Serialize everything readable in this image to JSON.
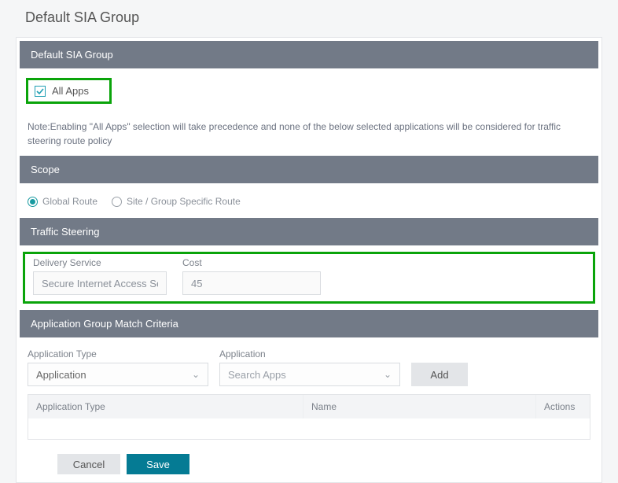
{
  "page_title": "Default SIA Group",
  "sections": {
    "group_header": "Default SIA Group",
    "scope_header": "Scope",
    "traffic_header": "Traffic Steering",
    "match_header": "Application Group Match Criteria"
  },
  "all_apps": {
    "label": "All Apps",
    "checked": true
  },
  "note": "Note:Enabling \"All Apps\" selection will take precedence and none of the below selected applications will be considered for traffic steering route policy",
  "scope": {
    "global": "Global Route",
    "site": "Site / Group Specific Route",
    "selected": "global"
  },
  "traffic": {
    "delivery_label": "Delivery Service",
    "delivery_value": "Secure Internet Access Serv",
    "cost_label": "Cost",
    "cost_value": "45"
  },
  "match": {
    "app_type_label": "Application Type",
    "app_type_value": "Application",
    "app_label": "Application",
    "app_placeholder": "Search Apps",
    "add_button": "Add"
  },
  "table": {
    "col_type": "Application Type",
    "col_name": "Name",
    "col_actions": "Actions"
  },
  "footer": {
    "cancel": "Cancel",
    "save": "Save"
  }
}
